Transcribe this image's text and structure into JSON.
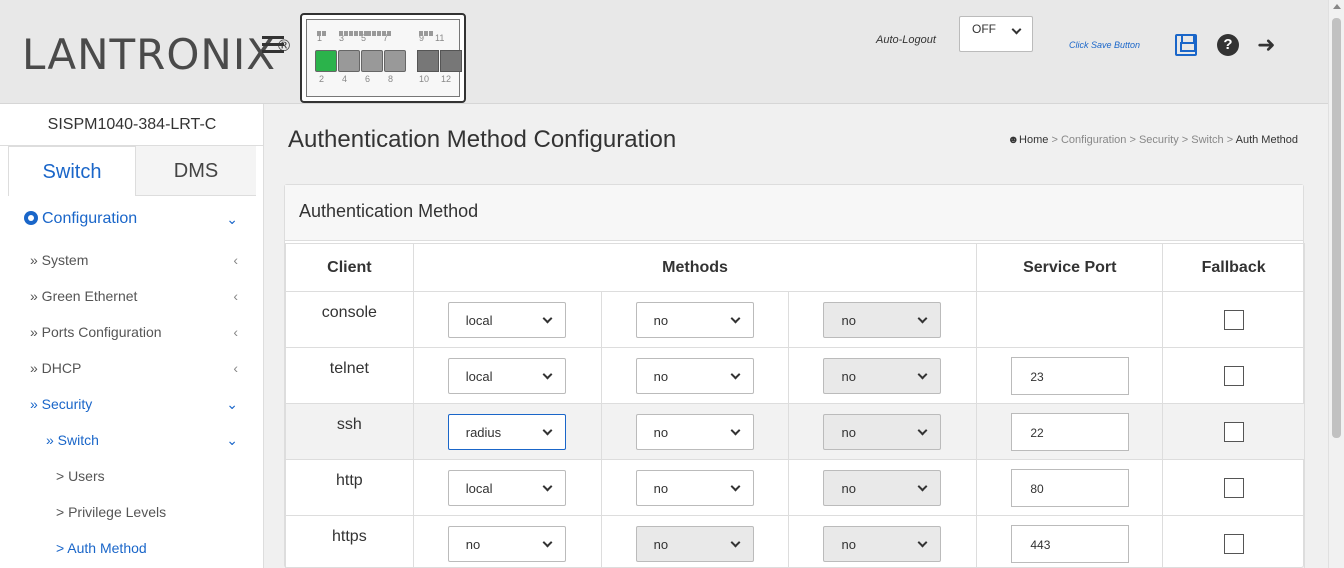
{
  "header": {
    "logo_text": "LANTRONIX",
    "logo_mark": "®",
    "auto_logout_label": "Auto-Logout",
    "auto_logout_value": "OFF",
    "save_hint": "Click Save Button",
    "device_ports_top": [
      "1",
      "3",
      "5",
      "7",
      "9",
      "11"
    ],
    "device_ports_bottom": [
      "2",
      "4",
      "6",
      "8",
      "10",
      "12"
    ]
  },
  "sidebar": {
    "model": "SISPM1040-384-LRT-C",
    "tabs": [
      {
        "label": "Switch"
      },
      {
        "label": "DMS"
      }
    ],
    "nav": {
      "configuration": "Configuration",
      "items": [
        {
          "label": "» System",
          "arrow": "‹"
        },
        {
          "label": "» Green Ethernet",
          "arrow": "‹"
        },
        {
          "label": "» Ports Configuration",
          "arrow": "‹"
        },
        {
          "label": "» DHCP",
          "arrow": "‹"
        },
        {
          "label": "» Security",
          "arrow": "⌄"
        },
        {
          "label": "» Switch",
          "arrow": "⌄"
        },
        {
          "label": "> Users"
        },
        {
          "label": "> Privilege Levels"
        },
        {
          "label": "> Auth Method"
        }
      ]
    }
  },
  "main": {
    "title": "Authentication Method Configuration",
    "breadcrumb": {
      "home": "Home",
      "path": [
        "Configuration",
        "Security",
        "Switch"
      ],
      "current": "Auth Method",
      "separator": ">"
    },
    "panel_title": "Authentication Method",
    "table": {
      "headers": {
        "client": "Client",
        "methods": "Methods",
        "service_port": "Service Port",
        "fallback": "Fallback"
      },
      "rows": [
        {
          "client": "console",
          "methods": [
            "local",
            "no",
            "no"
          ],
          "service_port": "",
          "fallback": false
        },
        {
          "client": "telnet",
          "methods": [
            "local",
            "no",
            "no"
          ],
          "service_port": "23",
          "fallback": false
        },
        {
          "client": "ssh",
          "methods": [
            "radius",
            "no",
            "no"
          ],
          "service_port": "22",
          "fallback": false
        },
        {
          "client": "http",
          "methods": [
            "local",
            "no",
            "no"
          ],
          "service_port": "80",
          "fallback": false
        },
        {
          "client": "https",
          "methods": [
            "no",
            "no",
            "no"
          ],
          "service_port": "443",
          "fallback": false
        }
      ]
    }
  },
  "colors": {
    "accent": "#1a66c9",
    "port_up": "#2bb34b"
  }
}
